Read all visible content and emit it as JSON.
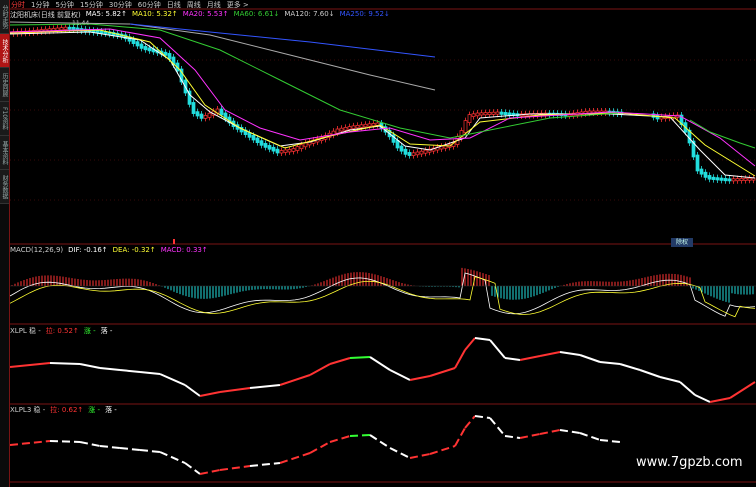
{
  "side_tabs": [
    "分时走势",
    "技术分析",
    "历史回顾",
    "F10资料",
    "基本资料",
    "财务数据"
  ],
  "side_active": 1,
  "timeframes": [
    "分时",
    "1分钟",
    "5分钟",
    "15分钟",
    "30分钟",
    "60分钟",
    "日线",
    "周线",
    "月线",
    "更多 >"
  ],
  "timeframe_active": 0,
  "main": {
    "title": "沈阳机床(日线 前复权)",
    "ma": [
      {
        "label": "MA5: 5.82",
        "arrow": "↑",
        "color": "#ffffff"
      },
      {
        "label": "MA10: 5.32",
        "arrow": "↑",
        "color": "#ffff33"
      },
      {
        "label": "MA20: 5.53",
        "arrow": "↑",
        "color": "#ff33ff"
      },
      {
        "label": "MA60: 6.61",
        "arrow": "↓",
        "color": "#33cc33"
      },
      {
        "label": "MA120: 7.60",
        "arrow": "↓",
        "color": "#cccccc"
      },
      {
        "label": "MA250: 9.52",
        "arrow": "↓",
        "color": "#3355ff"
      }
    ],
    "price_tag": "11.44"
  },
  "macd": {
    "params": "MACD(12,26,9)",
    "items": [
      {
        "label": "DIF: -0.16",
        "arrow": "↑",
        "color": "#ffffff"
      },
      {
        "label": "DEA: -0.32",
        "arrow": "↑",
        "color": "#ffff33"
      },
      {
        "label": "MACD: 0.33",
        "arrow": "↑",
        "color": "#ff33ff"
      }
    ]
  },
  "xlpl": {
    "name": "XLPL 稳 -",
    "items": [
      {
        "label": "拉: 0.52",
        "arrow": "↑",
        "color": "#ff3333"
      },
      {
        "label": "涨 -",
        "arrow": "",
        "color": "#33ff33"
      },
      {
        "label": "落 -",
        "arrow": "",
        "color": "#ffffff"
      }
    ]
  },
  "xlpl3": {
    "name": "XLPL3 稳 -",
    "items": [
      {
        "label": "拉: 0.62",
        "arrow": "↑",
        "color": "#ff3333"
      },
      {
        "label": "涨 -",
        "arrow": "",
        "color": "#33ff33"
      },
      {
        "label": "落 -",
        "arrow": "",
        "color": "#ffffff"
      }
    ]
  },
  "badge": "除权",
  "watermark": "www.7gpzb.com",
  "colors": {
    "up": "#ff3333",
    "down": "#22dddd",
    "grid": "#7a1414",
    "rise": "#33ff33",
    "fall": "#ffffff"
  }
}
